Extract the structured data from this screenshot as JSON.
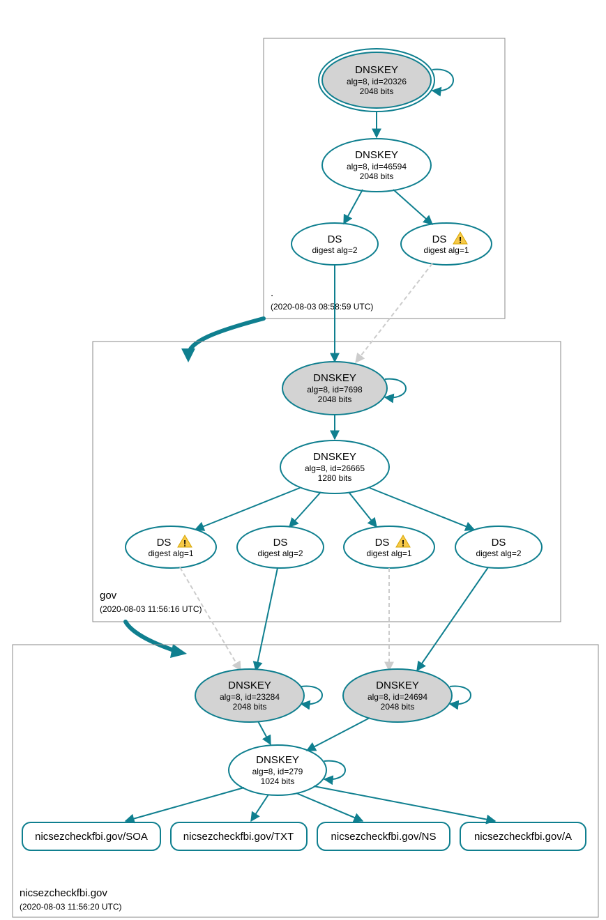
{
  "zones": {
    "root": {
      "label": ".",
      "time": "(2020-08-03 08:58:59 UTC)"
    },
    "gov": {
      "label": "gov",
      "time": "(2020-08-03 11:56:16 UTC)"
    },
    "leaf": {
      "label": "nicsezcheckfbi.gov",
      "time": "(2020-08-03 11:56:20 UTC)"
    }
  },
  "nodes": {
    "root_ksk": {
      "title": "DNSKEY",
      "line2": "alg=8, id=20326",
      "line3": "2048 bits"
    },
    "root_zsk": {
      "title": "DNSKEY",
      "line2": "alg=8, id=46594",
      "line3": "2048 bits"
    },
    "root_ds2": {
      "title": "DS",
      "line2": "digest alg=2"
    },
    "root_ds1": {
      "title": "DS",
      "line2": "digest alg=1"
    },
    "gov_ksk": {
      "title": "DNSKEY",
      "line2": "alg=8, id=7698",
      "line3": "2048 bits"
    },
    "gov_zsk": {
      "title": "DNSKEY",
      "line2": "alg=8, id=26665",
      "line3": "1280 bits"
    },
    "gov_ds1a": {
      "title": "DS",
      "line2": "digest alg=1"
    },
    "gov_ds2a": {
      "title": "DS",
      "line2": "digest alg=2"
    },
    "gov_ds1b": {
      "title": "DS",
      "line2": "digest alg=1"
    },
    "gov_ds2b": {
      "title": "DS",
      "line2": "digest alg=2"
    },
    "leaf_ksk1": {
      "title": "DNSKEY",
      "line2": "alg=8, id=23284",
      "line3": "2048 bits"
    },
    "leaf_ksk2": {
      "title": "DNSKEY",
      "line2": "alg=8, id=24694",
      "line3": "2048 bits"
    },
    "leaf_zsk": {
      "title": "DNSKEY",
      "line2": "alg=8, id=279",
      "line3": "1024 bits"
    },
    "rr_soa": {
      "title": "nicsezcheckfbi.gov/SOA"
    },
    "rr_txt": {
      "title": "nicsezcheckfbi.gov/TXT"
    },
    "rr_ns": {
      "title": "nicsezcheckfbi.gov/NS"
    },
    "rr_a": {
      "title": "nicsezcheckfbi.gov/A"
    }
  }
}
